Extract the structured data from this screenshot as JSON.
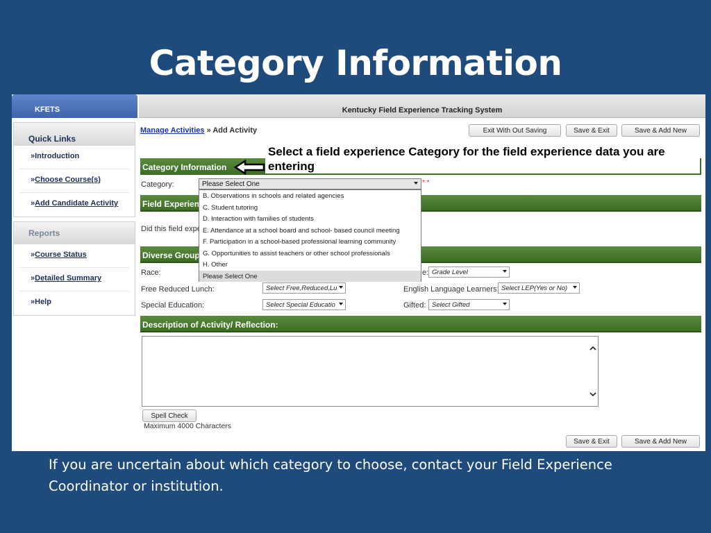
{
  "slide": {
    "title": "Category Information",
    "footer": "If you are uncertain about which category to choose, contact your Field Experience Coordinator or institution."
  },
  "sidebar": {
    "brand": "KFETS",
    "quick_links_title": "Quick Links",
    "quick_links": [
      {
        "prefix": "»",
        "label": "Introduction",
        "underline": false
      },
      {
        "prefix": "»",
        "label": "Choose Course(s)",
        "underline": true
      },
      {
        "prefix": "»",
        "label": "Add Candidate Activity",
        "underline": true
      }
    ],
    "reports_title": "Reports",
    "reports": [
      {
        "prefix": "»",
        "label": "Course Status",
        "underline": true
      },
      {
        "prefix": "»",
        "label": "Detailed Summary",
        "underline": true
      },
      {
        "prefix": "»",
        "label": "Help",
        "underline": false
      }
    ]
  },
  "header": {
    "system_title": "Kentucky Field Experience Tracking System",
    "breadcrumb_link": "Manage Activities",
    "breadcrumb_sep": "»",
    "breadcrumb_current": "Add Activity",
    "buttons": {
      "exit": "Exit With Out Saving",
      "save_exit": "Save & Exit",
      "save_add": "Save & Add New"
    }
  },
  "callout": "Select a field experience Category for the field experience data you are entering",
  "category": {
    "section": "Category Information",
    "label": "Category:",
    "selected": "Please Select One",
    "required_mark": "* *",
    "options": [
      "B. Observations in schools and related agencies",
      "C. Student tutoring",
      "D. Interaction with families of students",
      "E. Attendance at a school board and school- based council meeting",
      "F. Participation in a school-based professional learning community",
      "G. Opportunities to assist teachers or other school professionals",
      "H. Other",
      "Please Select One"
    ]
  },
  "field_experience": {
    "section": "Field Experienc",
    "question": "Did this field expe"
  },
  "diverse_groups": {
    "section": "Diverse Groups",
    "race_label": "Race:",
    "grade_label_partial": "e:",
    "grade_value": "Grade Level",
    "frl_label": "Free Reduced Lunch:",
    "frl_value": "Select Free,Reduced,Lu",
    "ell_label": "English Language Learners:",
    "ell_value": "Select LEP(Yes or No)",
    "sped_label": "Special Education:",
    "sped_value": "Select Special Educatio",
    "gifted_label": "Gifted:",
    "gifted_value": "Select Gifted"
  },
  "description": {
    "section": "Description of Activity/ Reflection:",
    "spell_check": "Spell Check",
    "max_chars": "Maximum 4000 Characters"
  },
  "icons": {
    "arrow": "left-arrow-outline-icon",
    "scroll_up": "chevron-up-icon",
    "scroll_down": "chevron-down-icon"
  },
  "colors": {
    "slide_bg": "#1f4a7c",
    "section_green": "#3b6d23",
    "brand_blue": "#3e64a9"
  }
}
